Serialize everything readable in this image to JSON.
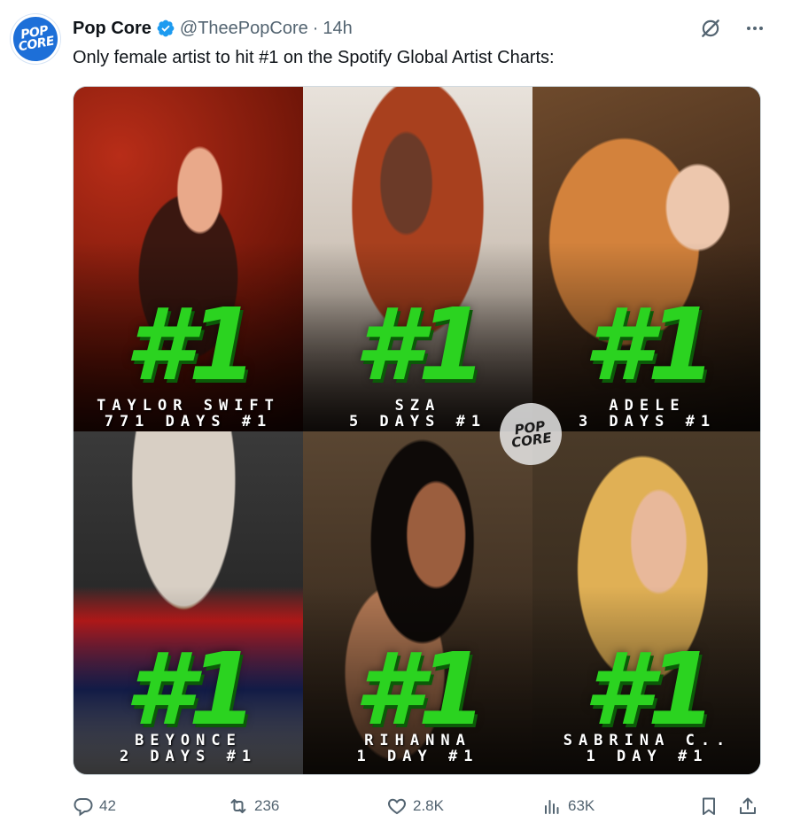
{
  "author": {
    "display_name": "Pop Core",
    "handle": "@TheePopCore",
    "separator": "·",
    "time": "14h",
    "avatar_text": "POP\nCORE"
  },
  "tweet_text": "Only female artist to hit #1 on the Spotify Global Artist Charts:",
  "media": {
    "watermark_text": "POP\nCORE",
    "tiles": [
      {
        "rank": "#1",
        "line1": "TAYLOR SWIFT",
        "line2": "771 DAYS #1"
      },
      {
        "rank": "#1",
        "line1": "SZA",
        "line2": "5 DAYS #1"
      },
      {
        "rank": "#1",
        "line1": "ADELE",
        "line2": "3 DAYS #1"
      },
      {
        "rank": "#1",
        "line1": "BEYONCE",
        "line2": "2 DAYS #1"
      },
      {
        "rank": "#1",
        "line1": "RIHANNA",
        "line2": "1 DAY #1"
      },
      {
        "rank": "#1",
        "line1": "SABRINA C..",
        "line2": "1 DAY #1"
      }
    ]
  },
  "actions": {
    "replies": "42",
    "reposts": "236",
    "likes": "2.8K",
    "views": "63K"
  },
  "icons": [
    "verified-icon",
    "grok-icon",
    "more-icon",
    "reply-icon",
    "repost-icon",
    "like-icon",
    "views-icon",
    "bookmark-icon",
    "share-icon"
  ],
  "colors": {
    "accent": "#1d9bf0",
    "rank_green": "#2bd320",
    "secondary_text": "#536471"
  }
}
